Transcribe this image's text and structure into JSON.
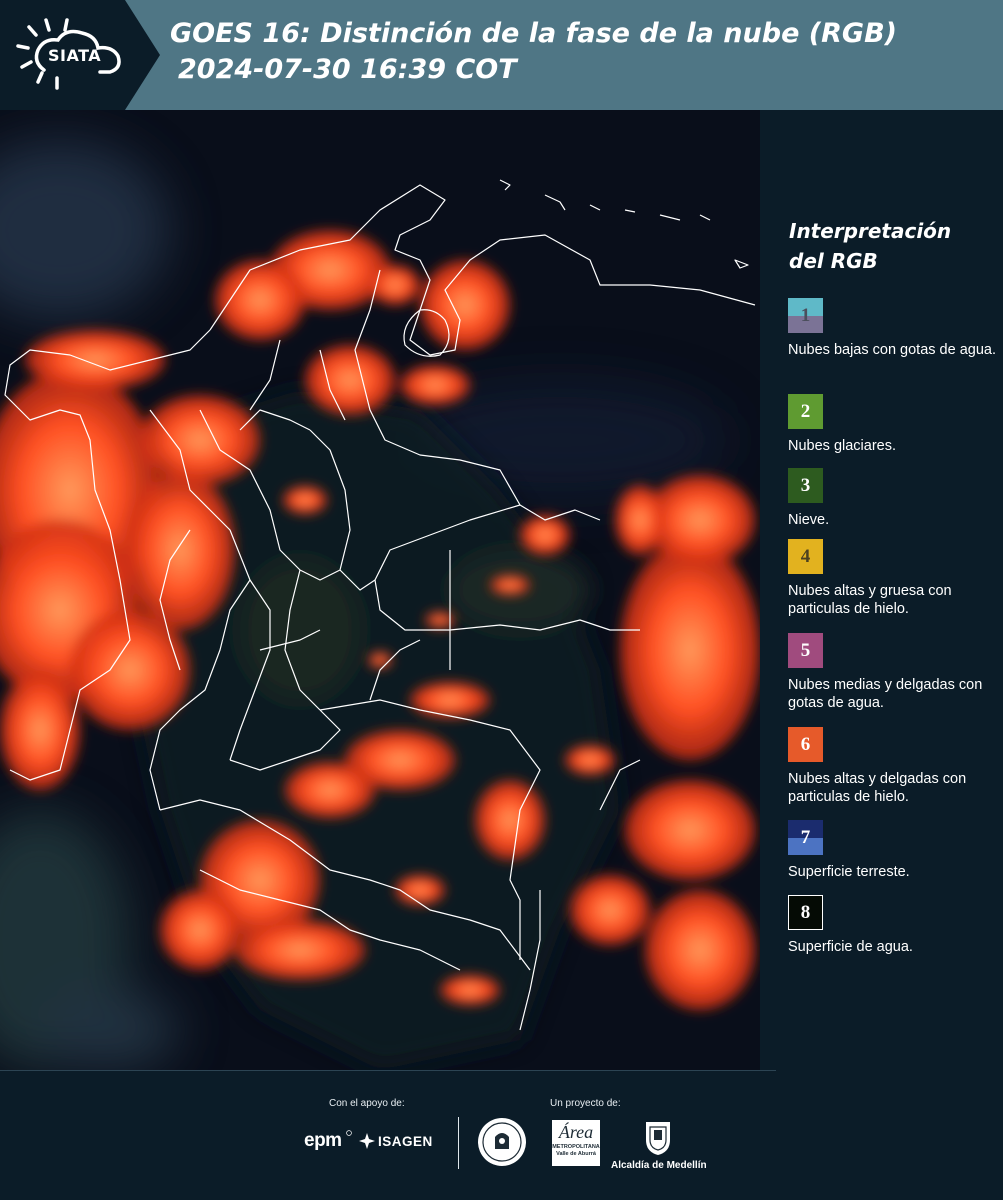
{
  "header": {
    "logo_text": "SIATA",
    "title_line1": "GOES 16: Distinción de la fase de la nube (RGB)",
    "title_line2": "2024-07-30 16:39 COT"
  },
  "legend": {
    "title": "Interpretación del RGB",
    "items": [
      {
        "num": "1",
        "label": "Nubes bajas con gotas de agua.",
        "color_top": "#5fb9c8",
        "color_bottom": "#7b7396",
        "num_color": "#4b4e5c"
      },
      {
        "num": "2",
        "label": "Nubes glaciares.",
        "color": "#5f9b31",
        "num_color": "#ffffff"
      },
      {
        "num": "3",
        "label": "Nieve.",
        "color": "#2d5b1f",
        "num_color": "#ffffff"
      },
      {
        "num": "4",
        "label": "Nubes altas y gruesa con particulas de hielo.",
        "color": "#e2b21f",
        "num_color": "#4a4020"
      },
      {
        "num": "5",
        "label": "Nubes medias y delgadas con gotas de agua.",
        "color": "#a04b7e",
        "num_color": "#ffffff"
      },
      {
        "num": "6",
        "label": "Nubes altas y delgadas con particulas de hielo.",
        "color": "#e65a2a",
        "num_color": "#ffffff"
      },
      {
        "num": "7",
        "label": "Superficie terreste.",
        "color_top": "#1b2c6e",
        "color_bottom": "#4c73c2",
        "num_color": "#ffffff"
      },
      {
        "num": "8",
        "label": "Superficie de agua.",
        "color": "#050b05",
        "num_color": "#ffffff",
        "border": "#ffffff"
      }
    ]
  },
  "footer": {
    "support_label": "Con el apoyo de:",
    "project_label": "Un proyecto de:",
    "epm": "epm",
    "isagen": "ISAGEN",
    "amva_word": "Área",
    "amva_sub1": "METROPOLITANA",
    "amva_sub2": "Valle de Aburrá",
    "alcaldia": "Alcaldía de Medellín"
  },
  "colors": {
    "header_bg": "#4f7685",
    "panel_bg": "#0b1c28",
    "cloud_red": "#ff4a1c",
    "cloud_orange": "#ff8a45",
    "border_white": "#ffffff"
  }
}
